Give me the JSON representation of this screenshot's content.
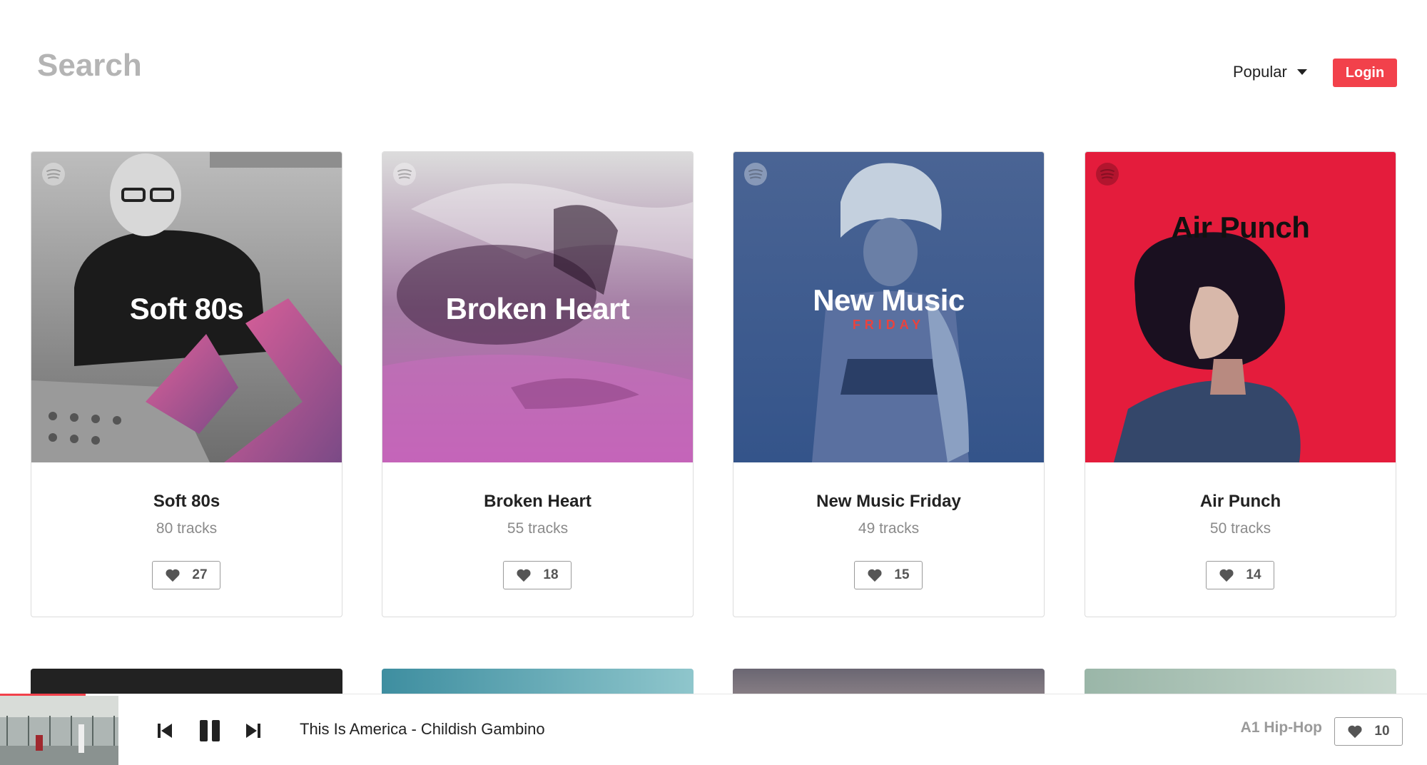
{
  "header": {
    "search_placeholder": "Search",
    "sort_label": "Popular",
    "login_label": "Login"
  },
  "playlists": [
    {
      "title": "Soft 80s",
      "tracks": "80 tracks",
      "likes": "27",
      "cover_text": "Soft 80s",
      "cover_subtext": "",
      "theme": "pink-bw"
    },
    {
      "title": "Broken Heart",
      "tracks": "55 tracks",
      "likes": "18",
      "cover_text": "Broken Heart",
      "cover_subtext": "",
      "theme": "purple"
    },
    {
      "title": "New Music Friday",
      "tracks": "49 tracks",
      "likes": "15",
      "cover_text": "New Music",
      "cover_subtext": "FRIDAY",
      "theme": "blue"
    },
    {
      "title": "Air Punch",
      "tracks": "50 tracks",
      "likes": "14",
      "cover_text": "Air Punch",
      "cover_subtext": "",
      "theme": "red"
    }
  ],
  "player": {
    "track": "This Is America - Childish Gambino",
    "playlist": "A1 Hip-Hop",
    "likes": "10",
    "progress_fraction": 0.06
  },
  "colors": {
    "accent": "#f2414b",
    "muted_text": "#8a8a8a",
    "border": "#dcdcdc"
  },
  "icons": [
    "spotify-icon",
    "heart-icon",
    "skip-back-icon",
    "pause-icon",
    "skip-forward-icon",
    "caret-down-icon"
  ]
}
